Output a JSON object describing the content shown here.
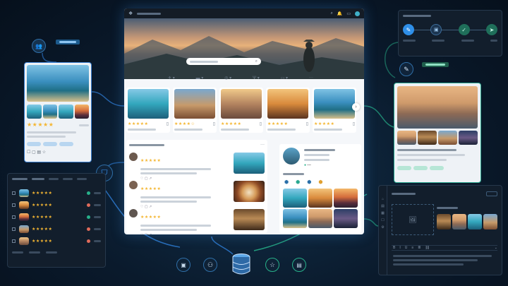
{
  "colors": {
    "accent": "#2f8fe8",
    "green_accent": "#27b08a",
    "star": "#f4b632",
    "background": "#0a1a2c"
  },
  "main_window": {
    "search_placeholder": "",
    "categories": [
      "plane-icon",
      "bed-icon",
      "camera-icon",
      "dining-icon",
      "car-icon",
      "more-icon"
    ],
    "destinations": [
      {
        "rating": "★★★★★"
      },
      {
        "rating": "★★★★☆"
      },
      {
        "rating": "★★★★★"
      },
      {
        "rating": "★★★★★"
      },
      {
        "rating": "★★★★★"
      }
    ],
    "reviews": [
      {
        "rating": "★★★★★"
      },
      {
        "rating": "★★★★★"
      },
      {
        "rating": "★★★★★"
      }
    ]
  },
  "left_card": {
    "rating": "★★★★★",
    "badge_icon": "users-icon"
  },
  "left_list": {
    "rows": [
      {
        "rating": "★★★★★",
        "status": "#27b08a"
      },
      {
        "rating": "★★★★★",
        "status": "#e06b5a"
      },
      {
        "rating": "★★★★★",
        "status": "#27b08a"
      },
      {
        "rating": "★★★★★",
        "status": "#e06b5a"
      },
      {
        "rating": "★★★★★",
        "status": "#e06b5a"
      }
    ]
  },
  "workflow_steps": [
    "pen-icon",
    "image-icon",
    "check-icon",
    "send-icon"
  ],
  "bottom_icons": [
    "image-icon",
    "user-icon",
    "database-icon",
    "star-icon",
    "document-icon"
  ]
}
